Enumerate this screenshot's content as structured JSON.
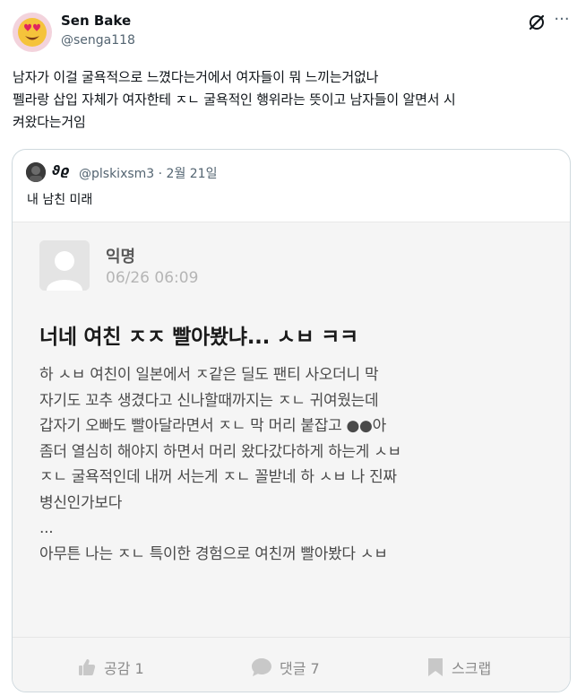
{
  "author": {
    "display_name": "Sen Bake",
    "handle": "@senga118",
    "avatar_emoji": "😍"
  },
  "tweet": {
    "lines": [
      "남자가 이걸 굴욕적으로 느꼈다는거에서 여자들이 뭐 느끼는거없나",
      "펠라랑 삽입 자체가 여자한테 ㅈㄴ 굴욕적인 행위라는 뜻이고 남자들이 알면서 시",
      "켜왔다는거임"
    ]
  },
  "quote": {
    "display_name": "ϑϱ",
    "meta": "@plskixsm3 · 2월 21일",
    "text": "내 남친 미래",
    "post": {
      "author": "익명",
      "time": "06/26 06:09",
      "title": "너네 여친 ㅈㅈ 빨아봤냐... ㅅㅂ ㅋㅋ",
      "body_lines": [
        "하 ㅅㅂ 여친이 일본에서 ㅈ같은 딜도 팬티 사오더니 막",
        "자기도 꼬추 생겼다고 신나할때까지는 ㅈㄴ 귀여웠는데",
        "갑자기 오빠도 빨아달라면서 ㅈㄴ 막 머리 붙잡고 ●●아",
        "좀더 열심히 해야지 하면서 머리 왔다갔다하게 하는게 ㅅㅂ",
        "ㅈㄴ 굴욕적인데 내꺼 서는게 ㅈㄴ 꼴받네 하 ㅅㅂ 나 진짜",
        "병신인가보다",
        "...",
        "아무튼 나는 ㅈㄴ 특이한 경험으로 여친꺼 빨아봤다 ㅅㅂ"
      ],
      "footer": {
        "like_label": "공감 1",
        "comment_label": "댓글 7",
        "scrap_label": "스크랩"
      }
    }
  },
  "icons": {
    "grok": "grok-icon",
    "more": "more-icon",
    "like": "thumbs-up-icon",
    "comment": "comment-bubble-icon",
    "scrap": "bookmark-icon"
  },
  "colors": {
    "text_primary": "#0f1419",
    "text_secondary": "#536471",
    "card_border": "#cfd9de",
    "screenshot_bg": "#f5f5f5"
  }
}
